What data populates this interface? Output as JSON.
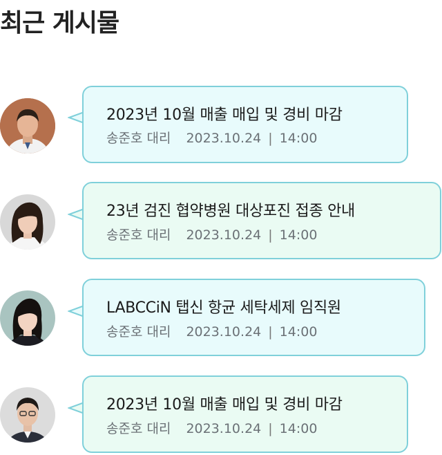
{
  "page_title": "최근 게시물",
  "posts": [
    {
      "title": "2023년 10월 매출 매입 및 경비 마감",
      "author": "송준호 대리",
      "date": "2023.10.24",
      "time": "14:00",
      "bubble_color": "#e8fbfc"
    },
    {
      "title": "23년 검진 협약병원 대상포진 접종 안내",
      "author": "송준호 대리",
      "date": "2023.10.24",
      "time": "14:00",
      "bubble_color": "#eafbf3"
    },
    {
      "title": "LABCCiN 탭신 항균 세탁세제 임직원",
      "author": "송준호 대리",
      "date": "2023.10.24",
      "time": "14:00",
      "bubble_color": "#e8fbfc"
    },
    {
      "title": "2023년 10월 매출 매입 및 경비 마감",
      "author": "송준호 대리",
      "date": "2023.10.24",
      "time": "14:00",
      "bubble_color": "#eafbf3"
    }
  ],
  "separator": "|",
  "colors": {
    "bubble_border": "#7fd0da",
    "title_text": "#222222",
    "meta_text": "#6b7176"
  }
}
